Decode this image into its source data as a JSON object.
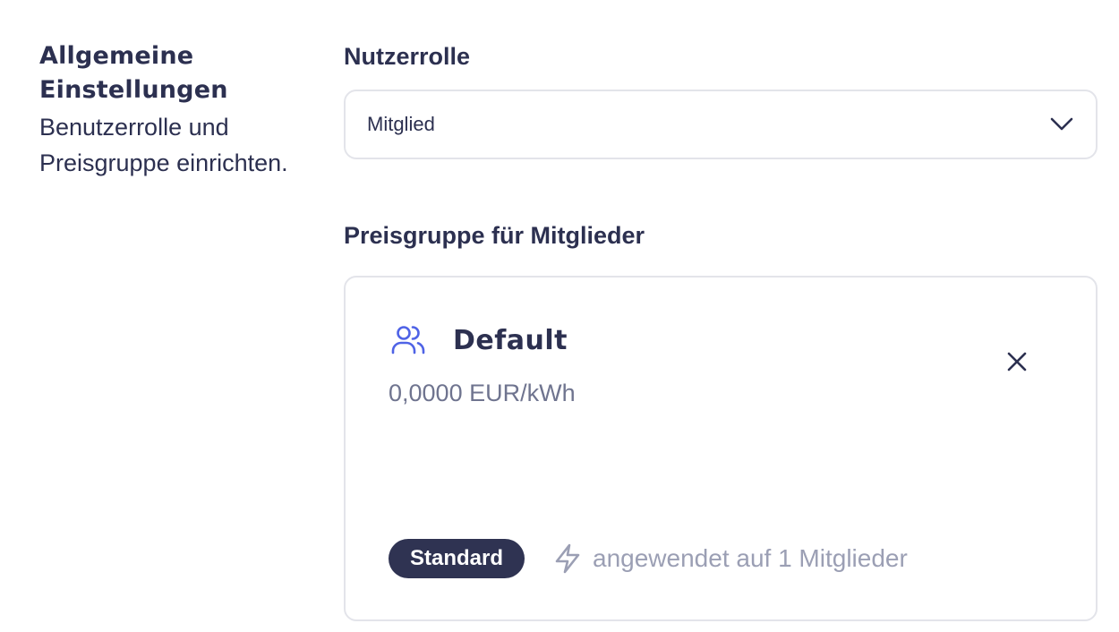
{
  "general_settings": {
    "title": "Allgemeine Einstellungen",
    "description": "Benutzerrolle und Preisgruppe einrichten."
  },
  "user_role": {
    "label": "Nutzerrolle",
    "selected": "Mitglied"
  },
  "price_group": {
    "label": "Preisgruppe für Mitglieder",
    "card": {
      "icon": "users-icon",
      "name": "Default",
      "price": "0,0000 EUR/kWh",
      "badge": "Standard",
      "applied_icon": "bolt-icon",
      "applied_text": "angewendet auf 1 Mitglieder"
    }
  },
  "colors": {
    "text_primary": "#2c3050",
    "text_muted": "#9b9fb4",
    "accent_icon": "#4f63e6",
    "badge_bg": "#2f3352",
    "border": "#e3e4ea"
  }
}
